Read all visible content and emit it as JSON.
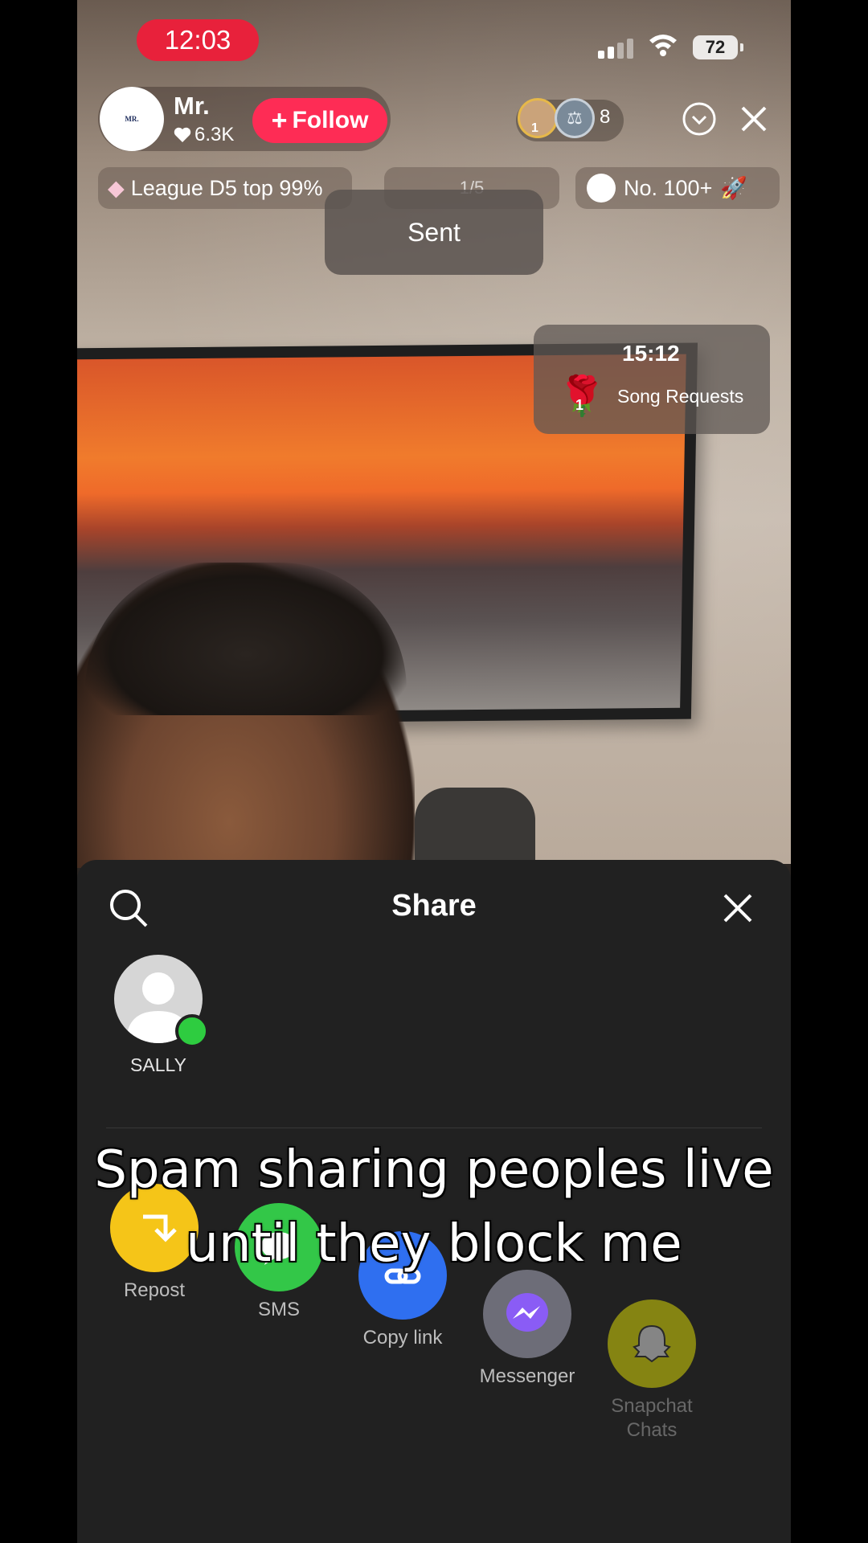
{
  "status_bar": {
    "time": "12:03",
    "battery": "72"
  },
  "host": {
    "avatar_text": "MR.",
    "name": "Mr.",
    "likes": "6.3K",
    "follow_label": "Follow"
  },
  "viewers": {
    "top_rank": "1",
    "count": "8"
  },
  "pills": {
    "league": "League D5 top 99%",
    "goal": "1/5",
    "rank": "No. 100+"
  },
  "toast": {
    "text": "Sent"
  },
  "song_card": {
    "time": "15:12",
    "label": "Song Requests",
    "rose_count": "1"
  },
  "share_sheet": {
    "title": "Share",
    "contacts": [
      {
        "name": "SALLY",
        "online": true
      }
    ],
    "apps": [
      {
        "label": "Repost",
        "icon": "repost-icon",
        "color": "#f5c518"
      },
      {
        "label": "SMS",
        "icon": "sms-icon",
        "color": "#33c748"
      },
      {
        "label": "Copy link",
        "icon": "link-icon",
        "color": "#2f6ff0"
      },
      {
        "label": "Messenger",
        "icon": "messenger-icon",
        "color": "#8a5cf5"
      },
      {
        "label": "Snapchat Chats",
        "icon": "snapchat-icon",
        "color": "#fffc00"
      }
    ]
  },
  "caption": {
    "line1": "Spam sharing peoples live",
    "line2": "until they block me"
  }
}
